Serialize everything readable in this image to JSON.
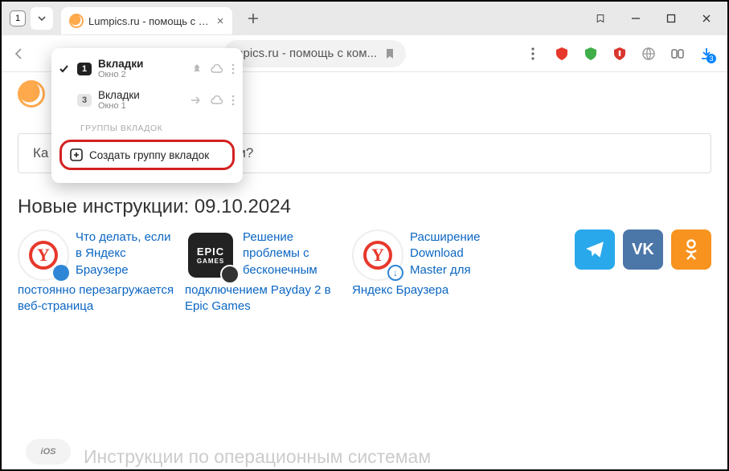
{
  "tabstrip": {
    "tab_count": "1",
    "active_tab_title": "Lumpics.ru - помощь с …"
  },
  "addressbar": {
    "omnibox_text": "mpics.ru - помощь с ком...",
    "download_badge": "3"
  },
  "dropdown": {
    "window1": {
      "count": "1",
      "title": "Вкладки",
      "subtitle": "Окно 2"
    },
    "window2": {
      "count": "3",
      "title": "Вкладки",
      "subtitle": "Окно 1"
    },
    "section_label": "Группы вкладок",
    "create_label": "Создать группу вкладок"
  },
  "page": {
    "search_fragment_left": "Ка",
    "search_fragment_right": "и?",
    "section_heading": "Новые инструкции: 09.10.2024",
    "card1_line1": "Что делать, если",
    "card1_line2": "в Яндекс",
    "card1_line3": "Браузере",
    "card1_rest": "постоянно перезагружается веб-страница",
    "card2_line1": "Решение",
    "card2_line2": "проблемы с",
    "card2_line3": "бесконечным",
    "card2_rest": "подключением Payday 2 в Epic Games",
    "card3_line1": "Расширение",
    "card3_line2": "Download",
    "card3_line3": "Master для",
    "card3_rest": "Яндекс Браузера",
    "ios_label": "iOS",
    "bottom_heading": "Инструкции по операционным системам"
  }
}
